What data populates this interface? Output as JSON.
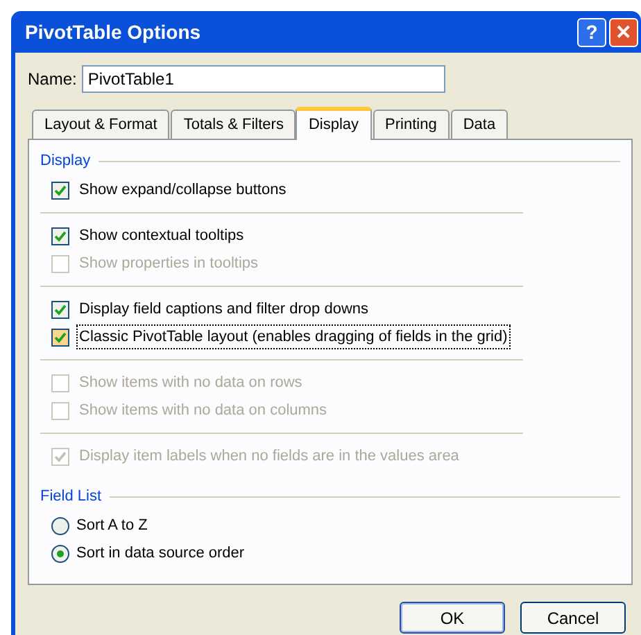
{
  "window": {
    "title": "PivotTable Options",
    "buttons": [
      {
        "kind": "help",
        "label": "?"
      },
      {
        "kind": "close",
        "label": "✕"
      }
    ]
  },
  "name_field": {
    "label": "Name:",
    "value": "PivotTable1"
  },
  "tabs": [
    {
      "label": "Layout & Format",
      "selected": false
    },
    {
      "label": "Totals & Filters",
      "selected": false
    },
    {
      "label": "Display",
      "selected": true
    },
    {
      "label": "Printing",
      "selected": false
    },
    {
      "label": "Data",
      "selected": false
    }
  ],
  "sections": [
    {
      "title": "Display",
      "groups": [
        [
          {
            "kind": "checkbox",
            "label": "Show expand/collapse buttons",
            "checked": true,
            "disabled": false,
            "focused": false
          }
        ],
        [
          {
            "kind": "checkbox",
            "label": "Show contextual tooltips",
            "checked": true,
            "disabled": false,
            "focused": false
          },
          {
            "kind": "checkbox",
            "label": "Show properties in tooltips",
            "checked": false,
            "disabled": true,
            "focused": false
          }
        ],
        [
          {
            "kind": "checkbox",
            "label": "Display field captions and filter drop downs",
            "checked": true,
            "disabled": false,
            "focused": false
          },
          {
            "kind": "checkbox",
            "label": "Classic PivotTable layout (enables dragging of fields in the grid)",
            "checked": true,
            "disabled": false,
            "focused": true
          }
        ],
        [
          {
            "kind": "checkbox",
            "label": "Show items with no data on rows",
            "checked": false,
            "disabled": true,
            "focused": false
          },
          {
            "kind": "checkbox",
            "label": "Show items with no data on columns",
            "checked": false,
            "disabled": true,
            "focused": false
          }
        ],
        [
          {
            "kind": "checkbox",
            "label": "Display item labels when no fields are in the values area",
            "checked": true,
            "disabled": true,
            "focused": false
          }
        ]
      ]
    },
    {
      "title": "Field List",
      "groups": [
        [
          {
            "kind": "radio",
            "label": "Sort A to Z",
            "selected": false
          },
          {
            "kind": "radio",
            "label": "Sort in data source order",
            "selected": true
          }
        ]
      ]
    }
  ],
  "buttons": [
    "OK",
    "Cancel"
  ]
}
